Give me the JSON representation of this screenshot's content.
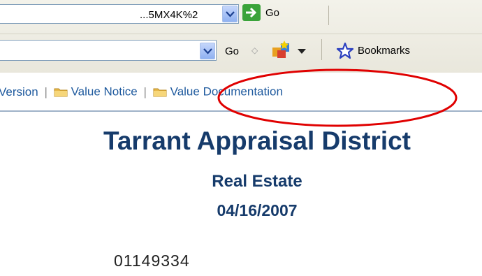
{
  "browser": {
    "address_value": "...5MX4K%2",
    "go_label": "Go",
    "search_go_label": "Go",
    "bookmarks_label": "Bookmarks"
  },
  "links": {
    "version_label": "Version",
    "value_notice_label": "Value Notice",
    "value_documentation_label": "Value Documentation",
    "separator": "|"
  },
  "page": {
    "title": "Tarrant Appraisal District",
    "subtitle": "Real Estate",
    "date": "04/16/2007",
    "account_number": "01149334"
  },
  "colors": {
    "heading": "#163b6b",
    "link": "#1f5a9e",
    "annotation": "#e00000"
  }
}
